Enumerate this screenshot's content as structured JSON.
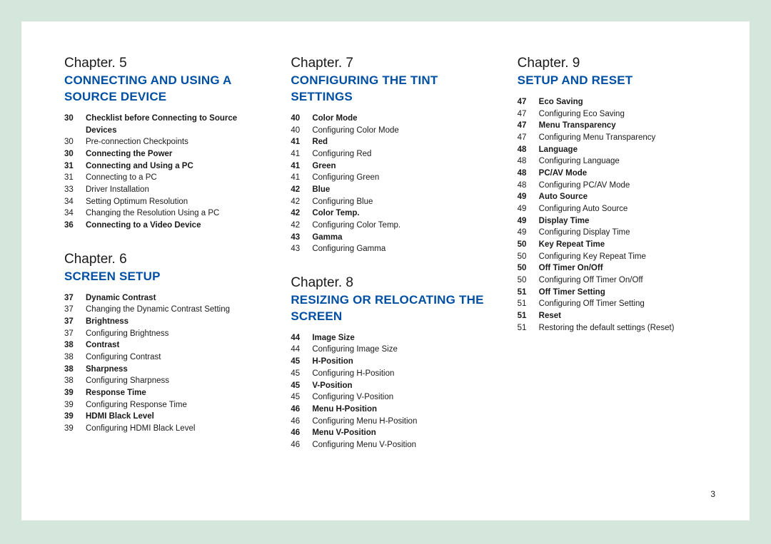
{
  "page_number": "3",
  "columns": [
    {
      "chapters": [
        {
          "label": "Chapter. 5",
          "title": "CONNECTING AND USING A SOURCE DEVICE",
          "entries": [
            {
              "page": "30",
              "text": "Checklist before Connecting to Source Devices",
              "bold": true
            },
            {
              "page": "30",
              "text": "Pre-connection Checkpoints",
              "bold": false
            },
            {
              "page": "30",
              "text": "Connecting the Power",
              "bold": true
            },
            {
              "page": "31",
              "text": "Connecting and Using a PC",
              "bold": true
            },
            {
              "page": "31",
              "text": "Connecting to a PC",
              "bold": false
            },
            {
              "page": "33",
              "text": "Driver Installation",
              "bold": false
            },
            {
              "page": "34",
              "text": "Setting Optimum Resolution",
              "bold": false
            },
            {
              "page": "34",
              "text": "Changing the Resolution Using a PC",
              "bold": false
            },
            {
              "page": "36",
              "text": "Connecting to a Video Device",
              "bold": true
            }
          ]
        },
        {
          "label": "Chapter. 6",
          "title": "SCREEN SETUP",
          "entries": [
            {
              "page": "37",
              "text": "Dynamic Contrast",
              "bold": true
            },
            {
              "page": "37",
              "text": "Changing the Dynamic Contrast Setting",
              "bold": false
            },
            {
              "page": "37",
              "text": "Brightness",
              "bold": true
            },
            {
              "page": "37",
              "text": "Configuring Brightness",
              "bold": false
            },
            {
              "page": "38",
              "text": "Contrast",
              "bold": true
            },
            {
              "page": "38",
              "text": "Configuring Contrast",
              "bold": false
            },
            {
              "page": "38",
              "text": "Sharpness",
              "bold": true
            },
            {
              "page": "38",
              "text": "Configuring Sharpness",
              "bold": false
            },
            {
              "page": "39",
              "text": "Response Time",
              "bold": true
            },
            {
              "page": "39",
              "text": "Configuring Response Time",
              "bold": false
            },
            {
              "page": "39",
              "text": "HDMI Black Level",
              "bold": true
            },
            {
              "page": "39",
              "text": "Configuring HDMI Black Level",
              "bold": false
            }
          ]
        }
      ]
    },
    {
      "chapters": [
        {
          "label": "Chapter. 7",
          "title": "CONFIGURING THE TINT SETTINGS",
          "entries": [
            {
              "page": "40",
              "text": "Color Mode",
              "bold": true
            },
            {
              "page": "40",
              "text": "Configuring Color Mode",
              "bold": false
            },
            {
              "page": "41",
              "text": "Red",
              "bold": true
            },
            {
              "page": "41",
              "text": "Configuring Red",
              "bold": false
            },
            {
              "page": "41",
              "text": "Green",
              "bold": true
            },
            {
              "page": "41",
              "text": "Configuring Green",
              "bold": false
            },
            {
              "page": "42",
              "text": "Blue",
              "bold": true
            },
            {
              "page": "42",
              "text": "Configuring Blue",
              "bold": false
            },
            {
              "page": "42",
              "text": "Color Temp.",
              "bold": true
            },
            {
              "page": "42",
              "text": "Configuring Color Temp.",
              "bold": false
            },
            {
              "page": "43",
              "text": "Gamma",
              "bold": true
            },
            {
              "page": "43",
              "text": "Configuring Gamma",
              "bold": false
            }
          ]
        },
        {
          "label": "Chapter. 8",
          "title": "RESIZING OR RELOCATING THE SCREEN",
          "entries": [
            {
              "page": "44",
              "text": "Image Size",
              "bold": true
            },
            {
              "page": "44",
              "text": "Configuring Image Size",
              "bold": false
            },
            {
              "page": "45",
              "text": "H-Position",
              "bold": true
            },
            {
              "page": "45",
              "text": "Configuring H-Position",
              "bold": false
            },
            {
              "page": "45",
              "text": "V-Position",
              "bold": true
            },
            {
              "page": "45",
              "text": "Configuring V-Position",
              "bold": false
            },
            {
              "page": "46",
              "text": "Menu H-Position",
              "bold": true
            },
            {
              "page": "46",
              "text": "Configuring Menu H-Position",
              "bold": false
            },
            {
              "page": "46",
              "text": "Menu V-Position",
              "bold": true
            },
            {
              "page": "46",
              "text": "Configuring Menu V-Position",
              "bold": false
            }
          ]
        }
      ]
    },
    {
      "chapters": [
        {
          "label": "Chapter. 9",
          "title": "SETUP AND RESET",
          "entries": [
            {
              "page": "47",
              "text": "Eco Saving",
              "bold": true
            },
            {
              "page": "47",
              "text": "Configuring Eco Saving",
              "bold": false
            },
            {
              "page": "47",
              "text": "Menu Transparency",
              "bold": true
            },
            {
              "page": "47",
              "text": "Configuring Menu Transparency",
              "bold": false
            },
            {
              "page": "48",
              "text": "Language",
              "bold": true
            },
            {
              "page": "48",
              "text": "Configuring Language",
              "bold": false
            },
            {
              "page": "48",
              "text": "PC/AV Mode",
              "bold": true
            },
            {
              "page": "48",
              "text": "Configuring PC/AV Mode",
              "bold": false
            },
            {
              "page": "49",
              "text": "Auto Source",
              "bold": true
            },
            {
              "page": "49",
              "text": "Configuring Auto Source",
              "bold": false
            },
            {
              "page": "49",
              "text": "Display Time",
              "bold": true
            },
            {
              "page": "49",
              "text": "Configuring Display Time",
              "bold": false
            },
            {
              "page": "50",
              "text": "Key Repeat Time",
              "bold": true
            },
            {
              "page": "50",
              "text": "Configuring Key Repeat Time",
              "bold": false
            },
            {
              "page": "50",
              "text": "Off Timer On/Off",
              "bold": true
            },
            {
              "page": "50",
              "text": "Configuring Off Timer On/Off",
              "bold": false
            },
            {
              "page": "51",
              "text": "Off Timer Setting",
              "bold": true
            },
            {
              "page": "51",
              "text": "Configuring Off Timer Setting",
              "bold": false
            },
            {
              "page": "51",
              "text": "Reset",
              "bold": true
            },
            {
              "page": "51",
              "text": "Restoring the default settings (Reset)",
              "bold": false
            }
          ]
        }
      ]
    }
  ]
}
